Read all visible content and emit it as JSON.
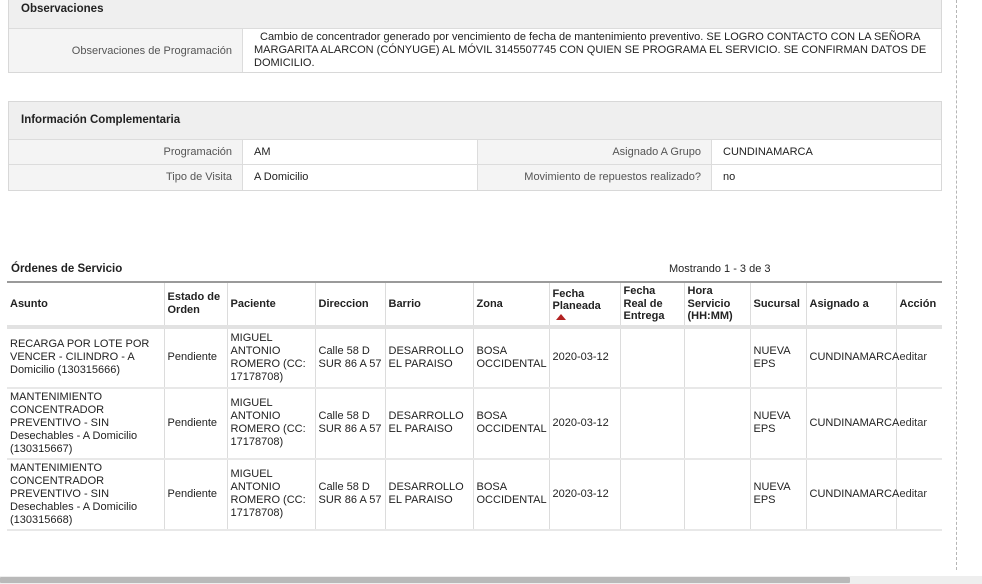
{
  "observaciones": {
    "title": "Observaciones",
    "label": "Observaciones de Programación",
    "value": "Cambio de concentrador generado por vencimiento de fecha de mantenimiento preventivo. SE LOGRO CONTACTO CON LA SEÑORA MARGARITA ALARCON (CÓNYUGE) AL MÓVIL 3145507745 CON QUIEN SE PROGRAMA EL SERVICIO. SE CONFIRMAN DATOS DE DOMICILIO."
  },
  "info": {
    "title": "Información Complementaria",
    "programacion_label": "Programación",
    "programacion_value": "AM",
    "grupo_label": "Asignado A Grupo",
    "grupo_value": "CUNDINAMARCA",
    "visita_label": "Tipo de Visita",
    "visita_value": "A Domicilio",
    "repuestos_label": "Movimiento de repuestos realizado?",
    "repuestos_value": "no"
  },
  "orders": {
    "title": "Órdenes de Servicio",
    "count": "Mostrando 1 - 3 de 3",
    "headers": [
      "Asunto",
      "Estado de Orden",
      "Paciente",
      "Direccion",
      "Barrio",
      "Zona",
      "Fecha Planeada",
      "Fecha Real de Entrega",
      "Hora Servicio (HH:MM)",
      "Sucursal",
      "Asignado a",
      "Acción"
    ],
    "rows": [
      {
        "asunto": "RECARGA POR LOTE POR VENCER - CILINDRO - A Domicilio (130315666)",
        "estado": "Pendiente",
        "paciente": "MIGUEL ANTONIO ROMERO (CC: 17178708)",
        "direccion": "Calle 58 D SUR 86 A 57",
        "barrio": "DESARROLLO EL PARAISO",
        "zona": "BOSA OCCIDENTAL",
        "fecha": "2020-03-12",
        "fecha_real": "",
        "hora": "",
        "sucursal": "NUEVA EPS",
        "asignado": "CUNDINAMARCA",
        "accion": "editar"
      },
      {
        "asunto": "MANTENIMIENTO CONCENTRADOR PREVENTIVO - SIN Desechables - A Domicilio (130315667)",
        "estado": "Pendiente",
        "paciente": "MIGUEL ANTONIO ROMERO (CC: 17178708)",
        "direccion": "Calle 58 D SUR 86 A 57",
        "barrio": "DESARROLLO EL PARAISO",
        "zona": "BOSA OCCIDENTAL",
        "fecha": "2020-03-12",
        "fecha_real": "",
        "hora": "",
        "sucursal": "NUEVA EPS",
        "asignado": "CUNDINAMARCA",
        "accion": "editar"
      },
      {
        "asunto": "MANTENIMIENTO CONCENTRADOR PREVENTIVO - SIN Desechables - A Domicilio (130315668)",
        "estado": "Pendiente",
        "paciente": "MIGUEL ANTONIO ROMERO (CC: 17178708)",
        "direccion": "Calle 58 D SUR 86 A 57",
        "barrio": "DESARROLLO EL PARAISO",
        "zona": "BOSA OCCIDENTAL",
        "fecha": "2020-03-12",
        "fecha_real": "",
        "hora": "",
        "sucursal": "NUEVA EPS",
        "asignado": "CUNDINAMARCA",
        "accion": "editar"
      }
    ]
  }
}
